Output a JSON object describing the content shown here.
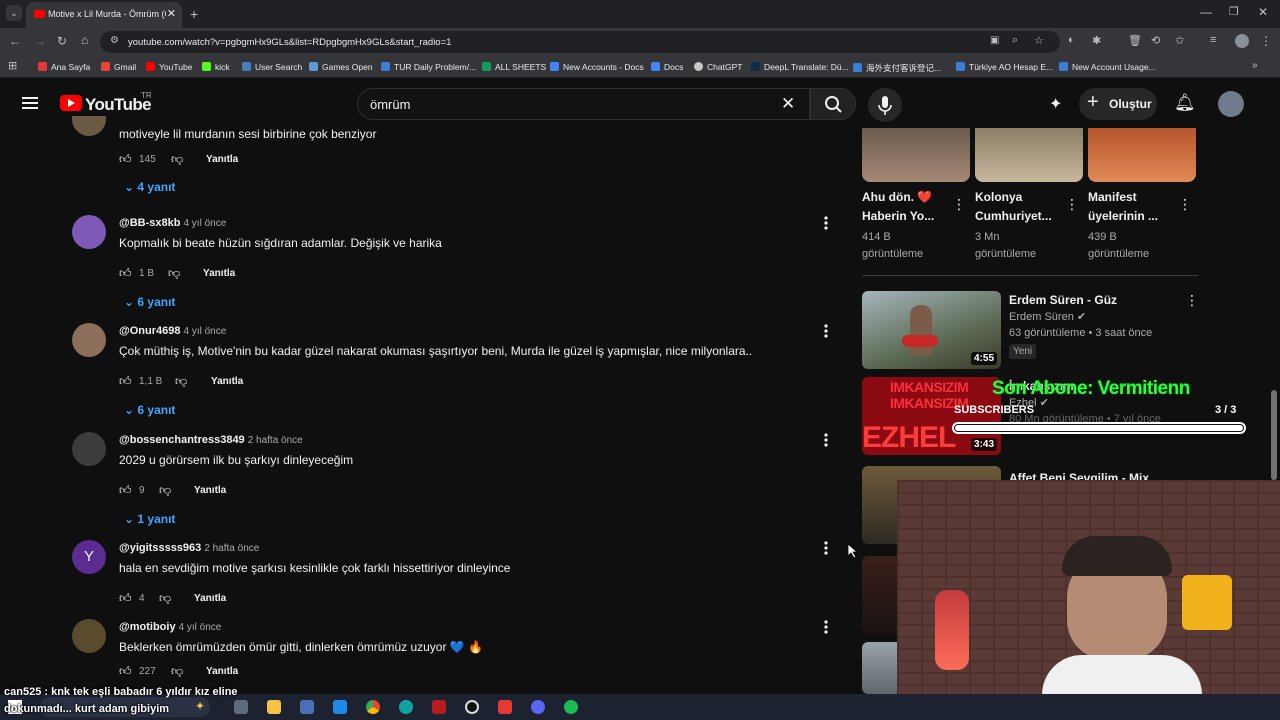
{
  "browser": {
    "tab_title": "Motive x Lil Murda - Ömrüm (O",
    "url": "youtube.com/watch?v=pgbgmHx9GLs&list=RDpgbgmHx9GLs&start_radio=1",
    "bookmarks": [
      "Ana Sayfa",
      "Gmail",
      "YouTube",
      "kick",
      "User Search",
      "Games Open",
      "TUR Daily Problem/...",
      "ALL SHEETS",
      "New Accounts - Docs",
      "Docs",
      "ChatGPT",
      "DeepL Translate: Dü...",
      "海外支付客诉登记...",
      "Türkiye AO Hesap E...",
      "New Account Usage..."
    ]
  },
  "header": {
    "logo": "YouTube",
    "region": "TR",
    "search_query": "ömrüm",
    "create_label": "Oluştur"
  },
  "comments": {
    "top_partial_text": "motiveyle lil murdanın sesi birbirine çok benziyor",
    "top_partial_likes": "145",
    "top_partial_reply": "Yanıtla",
    "top_partial_replies": "4 yanıt",
    "items": [
      {
        "handle": "@BB-sx8kb",
        "time": "4 yıl önce",
        "text": "Kopmalık bi beate hüzün sığdıran adamlar. Değişik ve harika",
        "likes": "1 B",
        "reply": "Yanıtla",
        "replies": "6 yanıt"
      },
      {
        "handle": "@Onur4698",
        "time": "4 yıl önce",
        "text": "Çok müthiş iş, Motive'nin bu kadar güzel nakarat okuması şaşırtıyor beni, Murda ile güzel iş yapmışlar, nice milyonlara..",
        "likes": "1,1 B",
        "reply": "Yanıtla",
        "replies": "6 yanıt"
      },
      {
        "handle": "@bossenchantress3849",
        "time": "2 hafta önce",
        "text": "2029 u görürsem ilk bu şarkıyı dinleyeceğim",
        "likes": "9",
        "reply": "Yanıtla",
        "replies": "1 yanıt"
      },
      {
        "handle": "@yigitsssss963",
        "time": "2 hafta önce",
        "text": "hala en sevdiğim motive şarkısı kesinlikle çok farklı hissettiriyor dinleyince",
        "likes": "4",
        "reply": "Yanıtla",
        "replies": "",
        "avatar_letter": "Y"
      },
      {
        "handle": "@motiboiy",
        "time": "4 yıl önce",
        "text": "Beklerken ömrümüzden ömür gitti, dinlerken ömrümüz uzuyor 💙 🔥",
        "likes": "227",
        "reply": "Yanıtla",
        "replies": ""
      }
    ]
  },
  "sidebar": {
    "shorts": [
      {
        "title1": "Ahu dön. ❤️",
        "title2": "Haberin Yo...",
        "views1": "414 B",
        "views2": "görüntüleme"
      },
      {
        "title1": "Kolonya",
        "title2": "Cumhuriyet...",
        "views1": "3 Mn",
        "views2": "görüntüleme"
      },
      {
        "title1": "Manifest",
        "title2": "üyelerinin ...",
        "views1": "439 B",
        "views2": "görüntüleme"
      }
    ],
    "videos": [
      {
        "title": "Erdem Süren - Güz",
        "channel": "Erdem Süren",
        "meta": "63 görüntüleme • 3 saat önce",
        "badge": "Yeni",
        "duration": "4:55"
      },
      {
        "title": "İmkansızım",
        "channel": "Ezhel",
        "meta": "80 Mn görüntüleme • 7 yıl önce",
        "thumb_text1": "IMKANSIZIM",
        "thumb_text2": "EZHEL",
        "duration": "3:43"
      },
      {
        "title": "Affet Beni Sevgilim - Mix",
        "channel": "",
        "meta": ""
      }
    ]
  },
  "overlay": {
    "last_sub_text": "Son Abone: Vermitienn",
    "subscribers_label": "SUBSCRIBERS",
    "subscribers_count": "3 / 3",
    "subscribers_progress": 1.0,
    "chat_line1": "can525 : knk tek eşli babadır 6 yıldır kız eline",
    "chat_line2": "dokunmadı... kurt adam gibiyim"
  },
  "colors": {
    "accent": "#ff0000",
    "link": "#3ea6ff",
    "bg": "#0f0f0f",
    "overlay_green": "#2bff3a"
  }
}
